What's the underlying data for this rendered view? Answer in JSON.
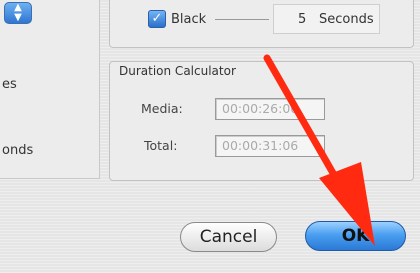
{
  "left_panel": {
    "labels": [
      "es",
      "onds"
    ]
  },
  "top_group": {
    "checkbox_checked": true,
    "checkbox_label": "Black",
    "seconds_value": "5",
    "seconds_unit": "Seconds"
  },
  "duration_calculator": {
    "title": "Duration Calculator",
    "media_label": "Media:",
    "media_value": "00:00:26:06",
    "total_label": "Total:",
    "total_value": "00:00:31:06"
  },
  "buttons": {
    "cancel": "Cancel",
    "ok": "OK"
  },
  "colors": {
    "accent_blue": "#3b8be6",
    "arrow_red": "#ff2a10"
  }
}
